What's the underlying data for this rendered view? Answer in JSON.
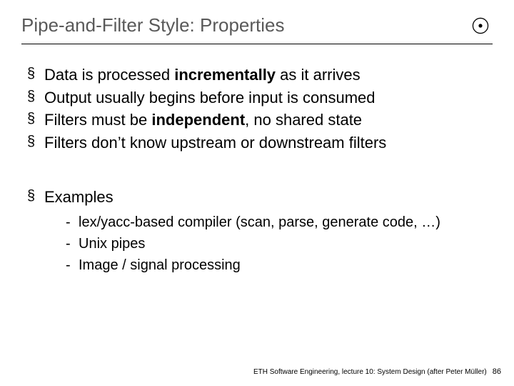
{
  "title": "Pipe-and-Filter Style: Properties",
  "bullets1": {
    "b1_pre": "Data is processed ",
    "b1_bold": "incrementally",
    "b1_post": " as it arrives",
    "b2": "Output usually begins before input is consumed",
    "b3_pre": "Filters must be ",
    "b3_bold": "independent",
    "b3_post": ", no shared state",
    "b4": "Filters don’t know upstream or downstream filters"
  },
  "examples_label": "Examples",
  "examples": {
    "e1": "lex/yacc-based compiler (scan, parse, generate code, …)",
    "e2": "Unix pipes",
    "e3": "Image / signal processing"
  },
  "footer": {
    "credit": "ETH Software Engineering, lecture 10: System Design (after Peter Müller)",
    "page": "86"
  }
}
